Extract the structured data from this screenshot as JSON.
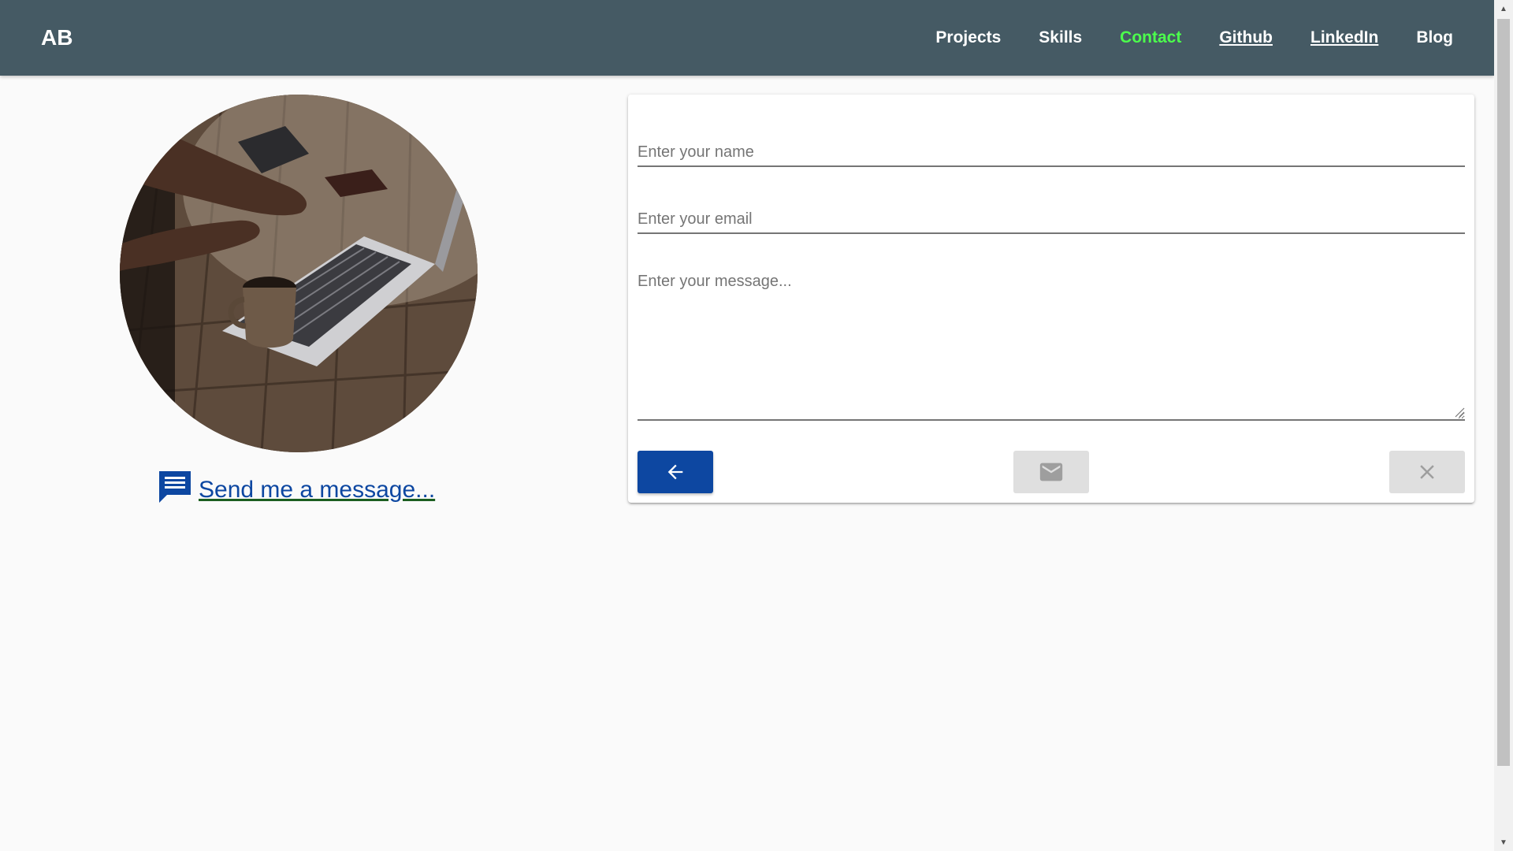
{
  "navbar": {
    "brand": "AB",
    "links": [
      {
        "label": "Projects",
        "underlined": false,
        "active": false
      },
      {
        "label": "Skills",
        "underlined": false,
        "active": false
      },
      {
        "label": "Contact",
        "underlined": false,
        "active": true
      },
      {
        "label": "Github",
        "underlined": true,
        "active": false
      },
      {
        "label": "LinkedIn",
        "underlined": true,
        "active": false
      },
      {
        "label": "Blog",
        "underlined": false,
        "active": false
      }
    ]
  },
  "profile": {
    "message_link": "Send me a message...",
    "icon": "chat-icon"
  },
  "form": {
    "name_placeholder": "Enter your name",
    "email_placeholder": "Enter your email",
    "message_placeholder": "Enter your message...",
    "back_icon": "arrow-left-icon",
    "send_icon": "mail-icon",
    "clear_icon": "close-icon"
  },
  "colors": {
    "navbar_bg": "#455a64",
    "active_link": "#4cff4c",
    "primary": "#0d47a1",
    "link_underline": "#1b5e20",
    "disabled_button": "#dfdfdf",
    "page_bg": "#fafafa"
  }
}
